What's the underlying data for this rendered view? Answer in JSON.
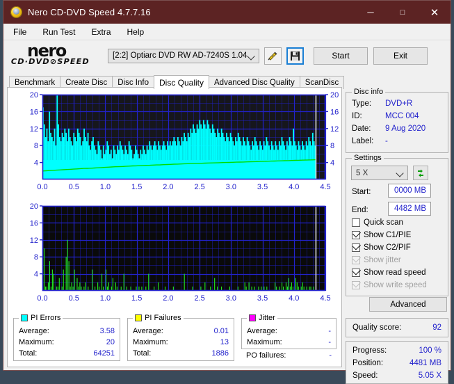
{
  "window": {
    "title": "Nero CD-DVD Speed 4.7.7.16",
    "app_icon": "nero-disc-icon",
    "minimize": "─",
    "maximize": "□",
    "close": "✕",
    "titlebar_color": "#5c2323"
  },
  "menu": {
    "items": [
      "File",
      "Run Test",
      "Extra",
      "Help"
    ]
  },
  "toolbar": {
    "logo_main": "nero",
    "logo_sub": "CD·DVD⊘SPEED",
    "drive": "[2:2]   Optiarc DVD RW AD-7240S 1.04",
    "plug_icon": "drive-plug-icon",
    "save_icon": "save-floppy-icon",
    "start_label": "Start",
    "exit_label": "Exit"
  },
  "tabs": {
    "items": [
      "Benchmark",
      "Create Disc",
      "Disc Info",
      "Disc Quality",
      "Advanced Disc Quality",
      "ScanDisc"
    ],
    "active": "Disc Quality"
  },
  "disc_info": {
    "title": "Disc info",
    "rows": [
      {
        "label": "Type:",
        "value": "DVD+R"
      },
      {
        "label": "ID:",
        "value": "MCC 004"
      },
      {
        "label": "Date:",
        "value": "9 Aug 2020"
      },
      {
        "label": "Label:",
        "value": "-"
      }
    ]
  },
  "settings": {
    "title": "Settings",
    "speed": "5 X",
    "refresh_icon": "refresh-arrows-icon",
    "start_label": "Start:",
    "start_value": "0000 MB",
    "end_label": "End:",
    "end_value": "4482 MB",
    "checkboxes": [
      {
        "label": "Quick scan",
        "checked": false,
        "enabled": true
      },
      {
        "label": "Show C1/PIE",
        "checked": true,
        "enabled": true
      },
      {
        "label": "Show C2/PIF",
        "checked": true,
        "enabled": true
      },
      {
        "label": "Show jitter",
        "checked": true,
        "enabled": false
      },
      {
        "label": "Show read speed",
        "checked": true,
        "enabled": true
      },
      {
        "label": "Show write speed",
        "checked": true,
        "enabled": false
      }
    ],
    "advanced_label": "Advanced"
  },
  "quality": {
    "label": "Quality score:",
    "value": "92"
  },
  "progress": {
    "rows": [
      {
        "label": "Progress:",
        "value": "100 %"
      },
      {
        "label": "Position:",
        "value": "4481 MB"
      },
      {
        "label": "Speed:",
        "value": "5.05 X"
      }
    ]
  },
  "stats": {
    "pi_errors": {
      "title": "PI Errors",
      "color": "#00ffff",
      "rows": [
        {
          "label": "Average:",
          "value": "3.58"
        },
        {
          "label": "Maximum:",
          "value": "20"
        },
        {
          "label": "Total:",
          "value": "64251"
        }
      ]
    },
    "pi_failures": {
      "title": "PI Failures",
      "color": "#ffff00",
      "rows": [
        {
          "label": "Average:",
          "value": "0.01"
        },
        {
          "label": "Maximum:",
          "value": "13"
        },
        {
          "label": "Total:",
          "value": "1886"
        }
      ]
    },
    "jitter": {
      "title": "Jitter",
      "color": "#ff00ff",
      "rows": [
        {
          "label": "Average:",
          "value": "-"
        },
        {
          "label": "Maximum:",
          "value": "-"
        }
      ],
      "po_label": "PO failures:",
      "po_value": "-"
    }
  },
  "chart_data": [
    {
      "type": "area",
      "name": "pi-errors-chart",
      "title": "PI Errors",
      "xlabel": "",
      "ylabel": "",
      "xlim": [
        0.0,
        4.5
      ],
      "ylim": [
        0,
        20
      ],
      "xticks": [
        "0.0",
        "0.5",
        "1.0",
        "1.5",
        "2.0",
        "2.5",
        "3.0",
        "3.5",
        "4.0",
        "4.5"
      ],
      "yticks": [
        "4",
        "8",
        "12",
        "16",
        "20"
      ],
      "grid": true,
      "plot_bg": "#16161c",
      "grid_color": "#2222cc",
      "scan_end_marker": 4.35,
      "series": [
        {
          "name": "PI Errors",
          "color": "#00ffff",
          "style": "filled-spikes",
          "values": [
            17,
            13,
            10,
            12,
            9,
            16,
            11,
            10,
            9,
            12,
            8,
            20,
            13,
            10,
            9,
            11,
            10,
            12,
            11,
            9,
            12,
            10,
            9,
            8,
            11,
            10,
            9,
            12,
            11,
            10,
            8,
            9,
            12,
            10,
            9,
            11,
            8,
            7,
            9,
            10,
            8,
            7,
            6,
            9,
            8,
            7,
            5,
            8,
            6,
            7,
            9,
            8,
            6,
            7,
            5,
            8,
            7,
            6,
            8,
            7,
            9,
            8,
            7,
            6,
            8,
            7,
            6,
            9,
            8,
            7,
            5,
            6,
            8,
            7,
            6,
            5,
            7,
            6,
            8,
            7,
            6,
            8,
            7,
            9,
            8,
            7,
            8,
            9,
            8,
            7,
            9,
            8,
            7,
            8,
            9,
            8,
            7,
            9,
            8,
            9,
            8,
            9,
            10,
            9,
            8,
            10,
            9,
            8,
            10,
            9,
            11,
            10,
            9,
            11,
            10,
            12,
            11,
            13,
            12,
            11,
            13,
            12,
            14,
            13,
            12,
            14,
            13,
            12,
            14,
            13,
            12,
            11,
            13,
            12,
            11,
            10,
            12,
            11,
            10,
            12,
            11,
            10,
            9,
            11,
            10,
            9,
            11,
            10,
            9,
            8,
            10,
            9,
            11,
            10,
            9,
            8,
            10,
            9,
            8,
            10,
            9,
            8,
            7,
            9,
            8,
            10,
            9,
            8,
            7,
            9,
            8,
            7,
            9,
            8,
            10,
            9,
            8,
            7,
            9,
            8,
            7,
            9,
            8,
            7,
            9,
            8,
            10,
            9,
            8,
            7,
            9,
            8,
            10,
            9,
            8,
            12,
            9,
            8,
            7,
            9,
            8,
            7,
            9,
            8,
            7,
            9,
            8,
            10,
            9,
            8,
            11,
            9,
            8
          ]
        },
        {
          "name": "Read speed",
          "color": "#00dd00",
          "style": "line",
          "values": [
            2.0,
            2.05,
            2.1,
            2.15,
            2.2,
            2.25,
            2.3,
            2.35,
            2.4,
            2.45,
            2.5,
            2.55,
            2.6,
            2.62,
            2.65,
            2.7,
            2.75,
            2.8,
            2.85,
            2.9,
            2.95,
            3.0,
            3.02,
            3.05,
            3.1,
            3.15,
            3.2,
            3.22,
            3.25,
            3.3,
            3.32,
            3.35,
            3.4,
            3.42,
            3.45,
            3.5,
            3.52,
            3.55,
            3.6,
            3.62,
            3.65,
            3.7,
            3.72,
            3.75,
            3.78,
            3.8,
            3.82,
            3.85,
            3.88,
            3.9,
            3.92,
            3.95,
            3.98,
            4.0,
            4.02,
            4.05,
            4.08,
            4.1,
            4.12,
            4.15,
            4.18,
            4.2,
            4.22,
            4.25,
            4.28,
            4.3,
            4.32,
            4.35,
            4.38,
            4.4,
            4.42,
            4.45,
            4.48,
            4.5,
            4.52,
            4.55,
            4.58,
            4.6,
            4.62,
            4.65
          ]
        }
      ]
    },
    {
      "type": "bar",
      "name": "pi-failures-chart",
      "title": "PI Failures",
      "xlabel": "",
      "ylabel": "",
      "xlim": [
        0.0,
        4.5
      ],
      "ylim": [
        0,
        20
      ],
      "xticks": [
        "0.0",
        "0.5",
        "1.0",
        "1.5",
        "2.0",
        "2.5",
        "3.0",
        "3.5",
        "4.0",
        "4.5"
      ],
      "yticks": [
        "4",
        "8",
        "12",
        "16",
        "20"
      ],
      "grid": true,
      "plot_bg": "#0a0a0a",
      "grid_color": "#2222cc",
      "scan_end_marker": 4.35,
      "series": [
        {
          "name": "PI Failures",
          "color": "#22ee22",
          "style": "spikes",
          "values": [
            13,
            10,
            1,
            1,
            2,
            7,
            1,
            5,
            4,
            0,
            1,
            1,
            3,
            0,
            1,
            5,
            0,
            8,
            12,
            7,
            1,
            2,
            1,
            5,
            0,
            3,
            1,
            2,
            1,
            0,
            1,
            2,
            0,
            1,
            0,
            0,
            5,
            0,
            1,
            0,
            2,
            1,
            0,
            4,
            1,
            0,
            5,
            1,
            2,
            0,
            1,
            3,
            0,
            2,
            1,
            0,
            0,
            1,
            0,
            4,
            0,
            1,
            0,
            0,
            1,
            0,
            0,
            0,
            1,
            0,
            1,
            0,
            1,
            0,
            0,
            1,
            0,
            4,
            0,
            0,
            0,
            1,
            0,
            0,
            2,
            0,
            0,
            0,
            0,
            1,
            0,
            0,
            0,
            0,
            0,
            1,
            0,
            0,
            0,
            0,
            0,
            0,
            0,
            4,
            0,
            0,
            0,
            0,
            0,
            1,
            0,
            0,
            0,
            0,
            0,
            1,
            0,
            0,
            2,
            0,
            0,
            0,
            1,
            0,
            0,
            3,
            0,
            1,
            0,
            0,
            1,
            0,
            0,
            0,
            0,
            0,
            1,
            0,
            0,
            0,
            0,
            0,
            1,
            0,
            0,
            0,
            0,
            2,
            1,
            0,
            2,
            0,
            1,
            0,
            1,
            0,
            0,
            1,
            0,
            1,
            0,
            1,
            0,
            1,
            0,
            0,
            0,
            0,
            0,
            2,
            1,
            0,
            1,
            0,
            2,
            1,
            0,
            2,
            1,
            3,
            1,
            2,
            1,
            0,
            3,
            2,
            1,
            0,
            1,
            2,
            1,
            0,
            1,
            0,
            1,
            1,
            0,
            1,
            0
          ]
        }
      ]
    }
  ]
}
